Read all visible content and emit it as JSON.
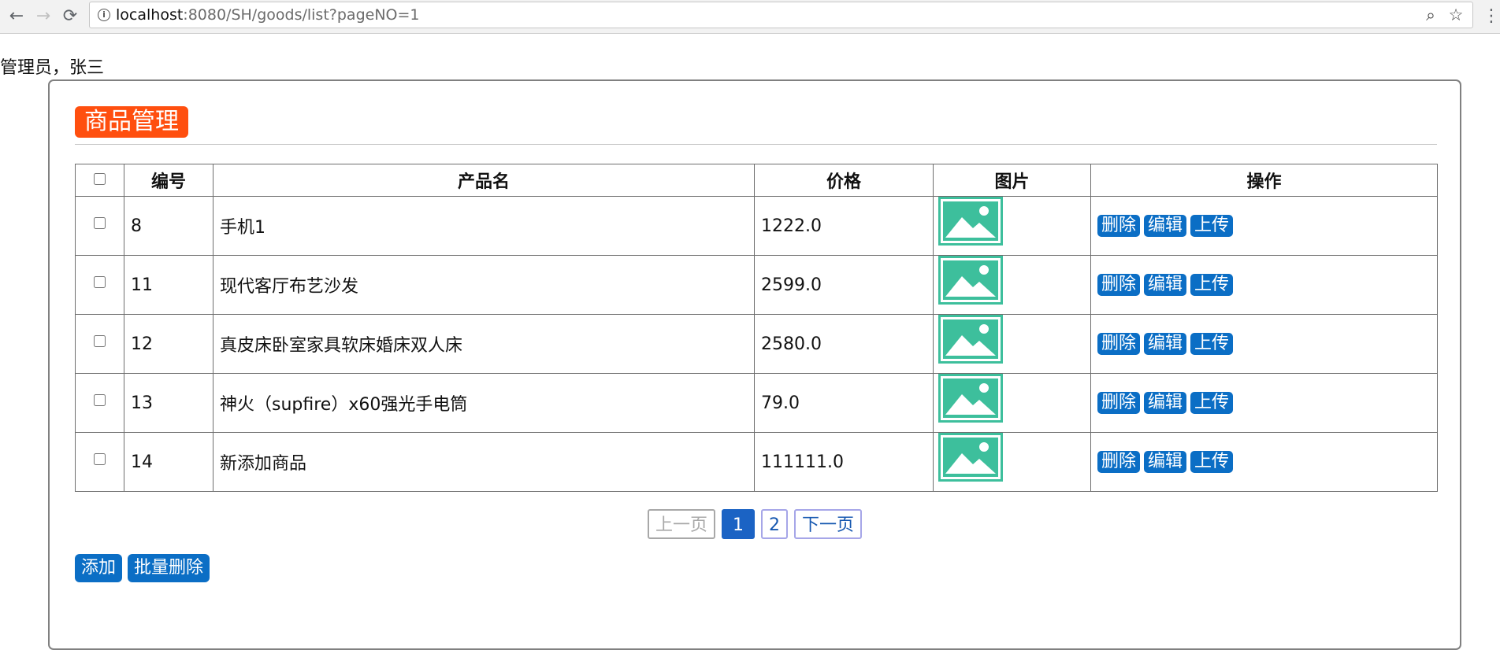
{
  "browser": {
    "url_host": "localhost",
    "url_rest": ":8080/SH/goods/list?pageNO=1",
    "back_glyph": "←",
    "forward_glyph": "→",
    "reload_glyph": "⟳",
    "info_glyph": "i",
    "zoom_glyph": "⌕",
    "star_glyph": "☆",
    "menu_glyph": "⋮"
  },
  "user": {
    "welcome": "管理员，张三"
  },
  "panel": {
    "title": "商品管理"
  },
  "table": {
    "headers": {
      "id": "编号",
      "name": "产品名",
      "price": "价格",
      "image": "图片",
      "actions": "操作"
    },
    "rows": [
      {
        "id": "8",
        "name": "手机1",
        "price": "1222.0"
      },
      {
        "id": "11",
        "name": "现代客厅布艺沙发",
        "price": "2599.0"
      },
      {
        "id": "12",
        "name": "真皮床卧室家具软床婚床双人床",
        "price": "2580.0"
      },
      {
        "id": "13",
        "name": "神火（supfire）x60强光手电筒",
        "price": "79.0"
      },
      {
        "id": "14",
        "name": "新添加商品",
        "price": "111111.0"
      }
    ],
    "row_actions": {
      "delete": "删除",
      "edit": "编辑",
      "upload": "上传"
    }
  },
  "pagination": {
    "prev": "上一页",
    "pages": [
      "1",
      "2"
    ],
    "current": "1",
    "next": "下一页"
  },
  "actions": {
    "add": "添加",
    "batch_delete": "批量删除"
  },
  "colors": {
    "title_badge": "#ff4f0f",
    "button_blue": "#0b6ec5",
    "active_page": "#1b63c4",
    "image_placeholder": "#3dbf9c"
  },
  "icons": {
    "image_placeholder": "image-placeholder-icon"
  }
}
